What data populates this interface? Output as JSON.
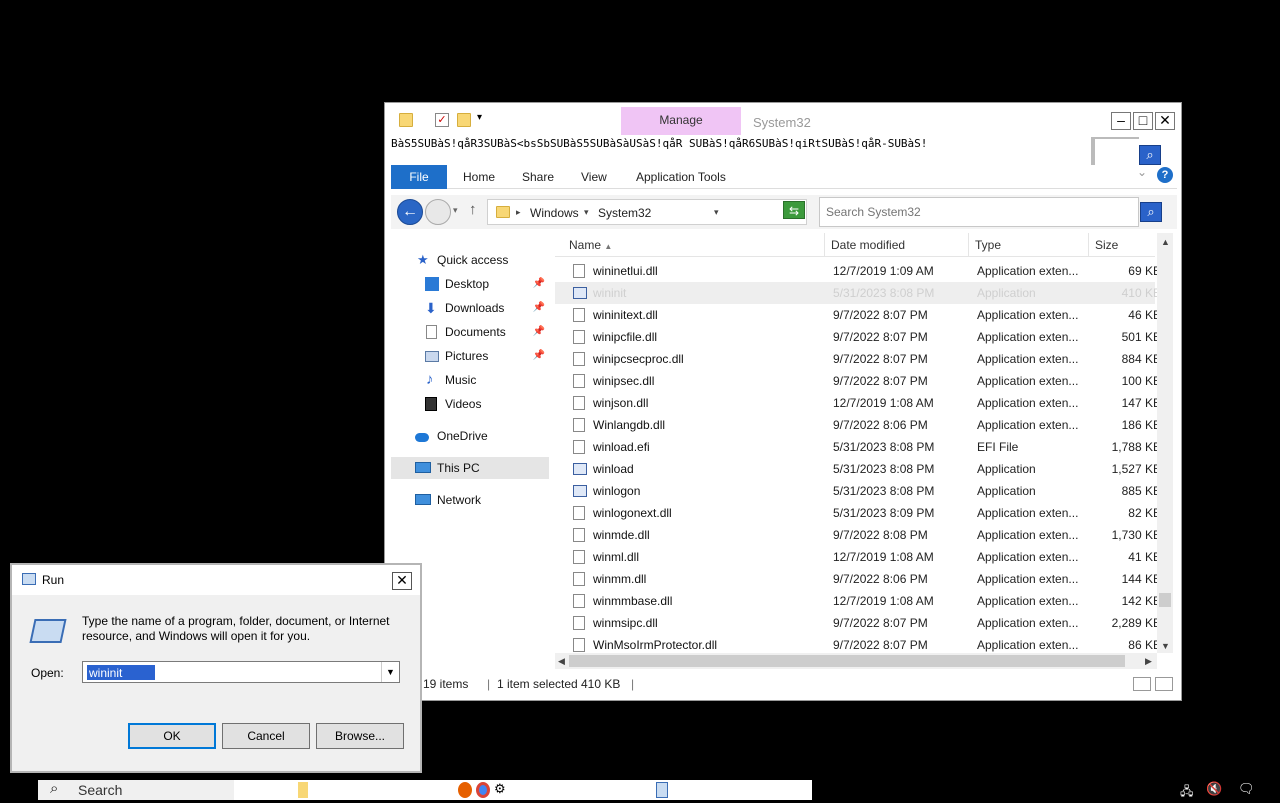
{
  "explorer": {
    "title": "System32",
    "manage_tab": "Manage",
    "garbled_line": "BàS5SUBàS!qåR3SUBàS<bsSbSUBàS5SUBàSàUSàS!qåR SUBàS!qåR6SUBàS!qiRtSUBàS!qåR-SUBàS!",
    "ribbon_tabs": [
      "File",
      "Home",
      "Share",
      "View",
      "Application Tools"
    ],
    "address": {
      "crumbs": [
        "Windows",
        "System32"
      ]
    },
    "search": {
      "placeholder": "Search System32"
    },
    "nav": {
      "quick_access": "Quick access",
      "desktop": "Desktop",
      "downloads": "Downloads",
      "documents": "Documents",
      "pictures": "Pictures",
      "music": "Music",
      "videos": "Videos",
      "onedrive": "OneDrive",
      "this_pc": "This PC",
      "network": "Network"
    },
    "columns": {
      "name": "Name",
      "date": "Date modified",
      "type": "Type",
      "size": "Size"
    },
    "files": [
      {
        "name": "wininetlui.dll",
        "date": "12/7/2019 1:09 AM",
        "type": "Application exten...",
        "size": "69 KB"
      },
      {
        "name": "wininit",
        "date": "5/31/2023 8:08 PM",
        "type": "Application",
        "size": "410 KB"
      },
      {
        "name": "wininitext.dll",
        "date": "9/7/2022 8:07 PM",
        "type": "Application exten...",
        "size": "46 KB"
      },
      {
        "name": "winipcfile.dll",
        "date": "9/7/2022 8:07 PM",
        "type": "Application exten...",
        "size": "501 KB"
      },
      {
        "name": "winipcsecproc.dll",
        "date": "9/7/2022 8:07 PM",
        "type": "Application exten...",
        "size": "884 KB"
      },
      {
        "name": "winipsec.dll",
        "date": "9/7/2022 8:07 PM",
        "type": "Application exten...",
        "size": "100 KB"
      },
      {
        "name": "winjson.dll",
        "date": "12/7/2019 1:08 AM",
        "type": "Application exten...",
        "size": "147 KB"
      },
      {
        "name": "Winlangdb.dll",
        "date": "9/7/2022 8:06 PM",
        "type": "Application exten...",
        "size": "186 KB"
      },
      {
        "name": "winload.efi",
        "date": "5/31/2023 8:08 PM",
        "type": "EFI File",
        "size": "1,788 KB"
      },
      {
        "name": "winload",
        "date": "5/31/2023 8:08 PM",
        "type": "Application",
        "size": "1,527 KB"
      },
      {
        "name": "winlogon",
        "date": "5/31/2023 8:08 PM",
        "type": "Application",
        "size": "885 KB"
      },
      {
        "name": "winlogonext.dll",
        "date": "5/31/2023 8:09 PM",
        "type": "Application exten...",
        "size": "82 KB"
      },
      {
        "name": "winmde.dll",
        "date": "9/7/2022 8:08 PM",
        "type": "Application exten...",
        "size": "1,730 KB"
      },
      {
        "name": "winml.dll",
        "date": "12/7/2019 1:08 AM",
        "type": "Application exten...",
        "size": "41 KB"
      },
      {
        "name": "winmm.dll",
        "date": "9/7/2022 8:06 PM",
        "type": "Application exten...",
        "size": "144 KB"
      },
      {
        "name": "winmmbase.dll",
        "date": "12/7/2019 1:08 AM",
        "type": "Application exten...",
        "size": "142 KB"
      },
      {
        "name": "winmsipc.dll",
        "date": "9/7/2022 8:07 PM",
        "type": "Application exten...",
        "size": "2,289 KB"
      },
      {
        "name": "WinMsoIrmProtector.dll",
        "date": "9/7/2022 8:07 PM",
        "type": "Application exten...",
        "size": "86 KB"
      }
    ],
    "status": {
      "items": "19 items",
      "selected": "1 item selected",
      "size": "410 KB"
    }
  },
  "run_dialog": {
    "title": "Run",
    "description": "Type the name of a program, folder, document, or Internet resource, and Windows will open it for you.",
    "open_label": "Open:",
    "open_value": "wininit",
    "ok": "OK",
    "cancel": "Cancel",
    "browse": "Browse..."
  },
  "taskbar": {
    "search": "Search"
  },
  "colors": {
    "accent": "#1e6fc9",
    "manage_tab": "#f0c5f5",
    "selection": "#2a62d0"
  }
}
